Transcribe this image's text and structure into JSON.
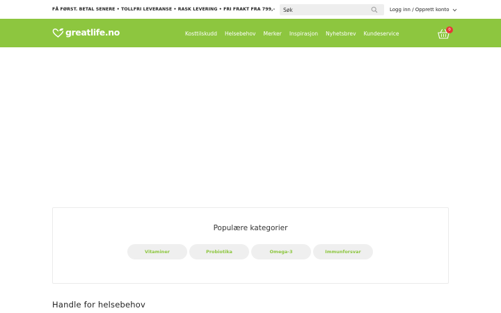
{
  "topbar": {
    "promo": "FÅ FØRST. BETAL SENERE • TOLLFRI LEVERANSE • RASK LEVERING • FRI FRAKT FRA 799,-",
    "search_placeholder": "Søk",
    "account_label": "Logg inn / Opprett konto"
  },
  "navbar": {
    "logo_text": "greatlife.no",
    "menu": [
      {
        "label": "Kosttilskudd"
      },
      {
        "label": "Helsebehov"
      },
      {
        "label": "Merker"
      },
      {
        "label": "Inspirasjon"
      },
      {
        "label": "Nyhetsbrev"
      },
      {
        "label": "Kundeservice"
      }
    ],
    "cart_count": "0"
  },
  "categories": {
    "title": "Populære kategorier",
    "items": [
      {
        "label": "Vitaminer"
      },
      {
        "label": "Probiotika"
      },
      {
        "label": "Omega-3"
      },
      {
        "label": "Immunforsvar"
      }
    ]
  },
  "section": {
    "title": "Handle for helsebehov"
  },
  "colors": {
    "brand_green": "#8dc63f",
    "badge_red": "#e53935",
    "pill_bg": "#efefef"
  },
  "icons": {
    "search": "search-icon",
    "chevron": "chevron-down-icon",
    "logo": "heart-leaf-icon",
    "cart": "basket-icon"
  }
}
